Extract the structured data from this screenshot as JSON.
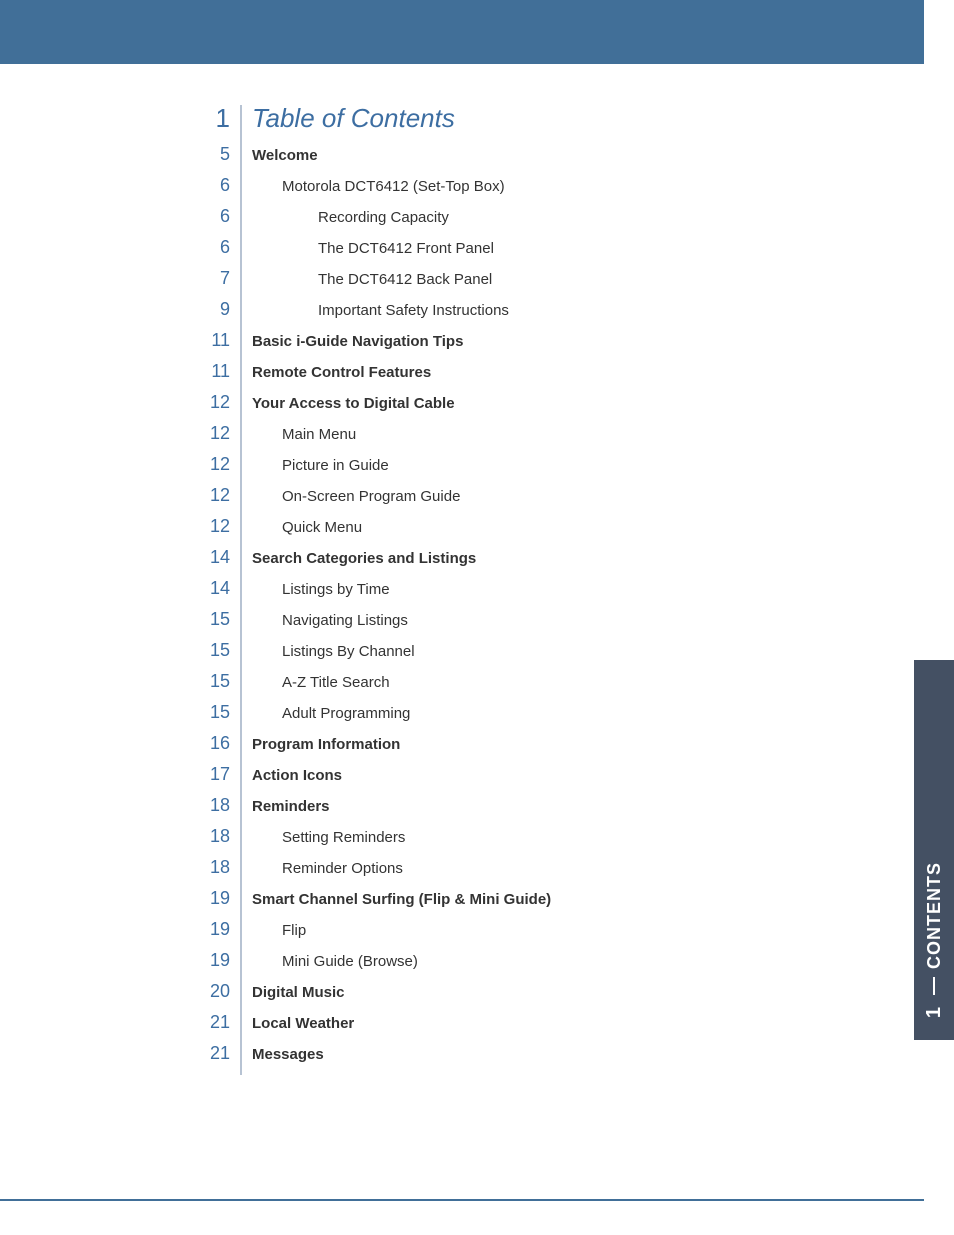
{
  "sideTab": {
    "label": "CONTENTS",
    "number": "1"
  },
  "toc": [
    {
      "page": "1",
      "level": 0,
      "text": "Table of Contents"
    },
    {
      "page": "5",
      "level": 1,
      "text": "Welcome"
    },
    {
      "page": "6",
      "level": 2,
      "text": "Motorola DCT6412 (Set-Top Box)"
    },
    {
      "page": "6",
      "level": 3,
      "text": "Recording Capacity"
    },
    {
      "page": "6",
      "level": 3,
      "text": "The DCT6412 Front Panel"
    },
    {
      "page": "7",
      "level": 3,
      "text": "The DCT6412 Back Panel"
    },
    {
      "page": "9",
      "level": 3,
      "text": "Important Safety Instructions"
    },
    {
      "page": "11",
      "level": 1,
      "text": "Basic i-Guide Navigation Tips"
    },
    {
      "page": "11",
      "level": 1,
      "text": "Remote Control Features"
    },
    {
      "page": "12",
      "level": 1,
      "text": "Your Access to Digital Cable"
    },
    {
      "page": "12",
      "level": 2,
      "text": "Main Menu"
    },
    {
      "page": "12",
      "level": 2,
      "text": "Picture in Guide"
    },
    {
      "page": "12",
      "level": 2,
      "text": "On-Screen Program Guide"
    },
    {
      "page": "12",
      "level": 2,
      "text": "Quick Menu"
    },
    {
      "page": "14",
      "level": 1,
      "text": "Search Categories and Listings"
    },
    {
      "page": "14",
      "level": 2,
      "text": "Listings by Time"
    },
    {
      "page": "15",
      "level": 2,
      "text": "Navigating Listings"
    },
    {
      "page": "15",
      "level": 2,
      "text": "Listings By Channel"
    },
    {
      "page": "15",
      "level": 2,
      "text": "A-Z Title Search"
    },
    {
      "page": "15",
      "level": 2,
      "text": "Adult Programming"
    },
    {
      "page": "16",
      "level": 1,
      "text": "Program Information"
    },
    {
      "page": "17",
      "level": 1,
      "text": "Action Icons"
    },
    {
      "page": "18",
      "level": 1,
      "text": "Reminders"
    },
    {
      "page": "18",
      "level": 2,
      "text": "Setting Reminders"
    },
    {
      "page": "18",
      "level": 2,
      "text": "Reminder Options"
    },
    {
      "page": "19",
      "level": 1,
      "text": "Smart Channel Surfing (Flip & Mini Guide)"
    },
    {
      "page": "19",
      "level": 2,
      "text": "Flip"
    },
    {
      "page": "19",
      "level": 2,
      "text": "Mini Guide (Browse)"
    },
    {
      "page": "20",
      "level": 1,
      "text": "Digital Music"
    },
    {
      "page": "21",
      "level": 1,
      "text": "Local Weather"
    },
    {
      "page": "21",
      "level": 1,
      "text": "Messages"
    }
  ]
}
